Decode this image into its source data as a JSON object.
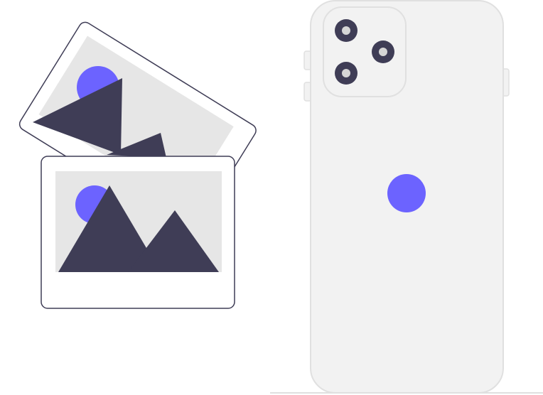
{
  "illustration": {
    "colors": {
      "accent": "#6c63ff",
      "dark": "#3f3d56",
      "photo_area": "#e6e6e6",
      "photo_frame": "#ffffff",
      "outline": "#3f3d56",
      "phone_body": "#f2f2f2",
      "phone_outline": "#e0e0e0",
      "lens_ring": "#3f3d56",
      "lens_glass": "#d6d6d6"
    },
    "icons": {
      "photo_back": "landscape-photo-icon",
      "photo_front": "landscape-photo-icon",
      "phone": "smartphone-back-icon",
      "camera": "camera-lens-icon"
    }
  }
}
